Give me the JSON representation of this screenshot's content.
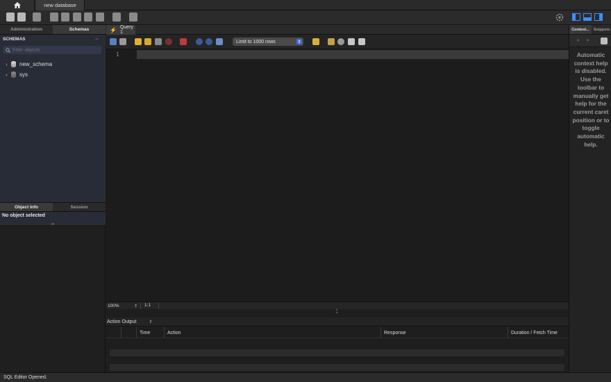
{
  "window": {
    "home_icon": "home-icon",
    "connection_tab": "new database"
  },
  "toolbar": {
    "icons": [
      "new-sql-tab-icon",
      "open-sql-script-icon",
      "inspector-icon",
      "create-schema-icon",
      "create-table-icon",
      "create-view-icon",
      "create-procedure-icon",
      "create-function-icon",
      "search-table-data-icon",
      "reconnect-icon"
    ],
    "right_icons": [
      "settings-gear-icon",
      "toggle-sidebar-icon",
      "toggle-output-icon",
      "toggle-secondary-sidebar-icon"
    ]
  },
  "left_panel": {
    "tabs": [
      "Administration",
      "Schemas"
    ],
    "active_tab": "Schemas",
    "schemas_header": "SCHEMAS",
    "filter_placeholder": "Filter objects",
    "schemas": [
      "new_schema",
      "sys"
    ],
    "info_tabs": [
      "Object Info",
      "Session"
    ],
    "object_info": "No object selected"
  },
  "editor": {
    "query_tab": "Query 1",
    "limit_rows": "Limit to 1000 rows",
    "line_number": "1",
    "zoom": "100%",
    "cursor_position": "1:1"
  },
  "output": {
    "selector": "Action Output",
    "columns": [
      "",
      "Time",
      "Action",
      "Response",
      "Duration / Fetch Time"
    ]
  },
  "right_panel": {
    "tabs": [
      "Context...",
      "Snippets"
    ],
    "help_text": "Automatic context help is disabled. Use the toolbar to manually get help for the current caret position or to toggle automatic help."
  },
  "status": {
    "message": "SQL Editor Opened."
  },
  "colors": {
    "schema_pane_bg": "#272c36",
    "accent_blue": "#3f6fd8"
  }
}
